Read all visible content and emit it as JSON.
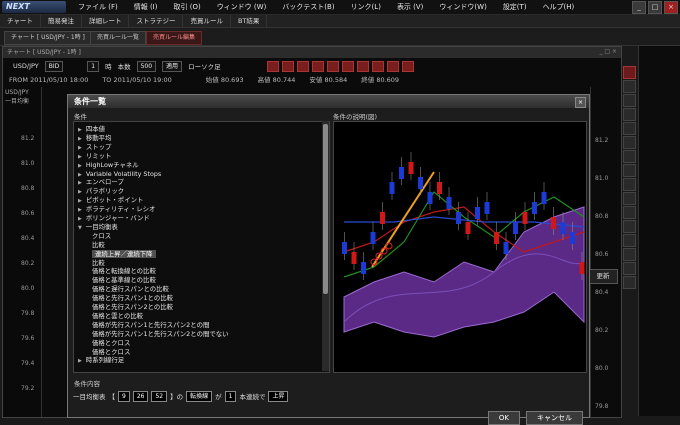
{
  "app": {
    "logo_text": "NEXT",
    "menu": [
      "ファイル (F)",
      "情報 (I)",
      "取引 (O)",
      "ウィンドウ (W)",
      "バックテスト(B)",
      "リンク(L)",
      "表示 (V)",
      "ウィンドウ(W)",
      "設定(T)",
      "ヘルプ(H)"
    ]
  },
  "toolbar": {
    "items": [
      "チャート",
      "簡易発注",
      "詳細レート",
      "ストラテジー",
      "売買ルール",
      "BT結果"
    ]
  },
  "tabs": [
    {
      "label": "チャート [ USD/JPY - 1時 ]"
    },
    {
      "label": "売買ルール一覧"
    },
    {
      "label": "売買ルール編集"
    }
  ],
  "chart_window": {
    "title": "チャート [ USD/JPY - 1時 ]",
    "symbol": "USD/JPY",
    "side": "BID",
    "period_value": "1",
    "period_unit": "時",
    "bars_label": "本数",
    "bars_value": "500",
    "apply_label": "適用",
    "candle_label": "ローソク足",
    "from_label": "FROM",
    "from_value": "2011/05/10 18:00",
    "to_label": "TO",
    "to_value": "2011/05/10 19:00",
    "open_label": "始値",
    "open_value": "80.693",
    "high_label": "高値",
    "high_value": "80.744",
    "low_label": "安値",
    "low_value": "80.584",
    "close_label": "終値",
    "close_value": "80.609",
    "left_label_line1": "USD/JPY",
    "left_label_line2": "一目均衡",
    "left_ticks": [
      "81.2",
      "81.0",
      "80.8",
      "80.6",
      "80.4",
      "80.2",
      "80.0",
      "79.8",
      "79.6",
      "79.4",
      "79.2"
    ],
    "right_ticks": [
      "81.2",
      "81.0",
      "80.8",
      "80.6",
      "80.4",
      "80.2",
      "80.0",
      "79.8"
    ],
    "refresh_label": "更新"
  },
  "dialog": {
    "title": "条件一覧",
    "conditions_header": "条件",
    "description_header": "条件の説明(図)",
    "content_header": "条件内容",
    "tree": [
      {
        "label": "四本値",
        "level": 0
      },
      {
        "label": "移動平均",
        "level": 0
      },
      {
        "label": "ストップ",
        "level": 0
      },
      {
        "label": "リミット",
        "level": 0
      },
      {
        "label": "HighLowチャネル",
        "level": 0
      },
      {
        "label": "Variable Volatility Stops",
        "level": 0
      },
      {
        "label": "エンベロープ",
        "level": 0
      },
      {
        "label": "パラボリック",
        "level": 0
      },
      {
        "label": "ピボット・ポイント",
        "level": 0
      },
      {
        "label": "ボラティリティ・レシオ",
        "level": 0
      },
      {
        "label": "ボリンジャー・バンド",
        "level": 0
      },
      {
        "label": "一目均衡表",
        "level": 0,
        "expanded": true
      },
      {
        "label": "クロス",
        "level": 1
      },
      {
        "label": "比較",
        "level": 1
      },
      {
        "label": "連続上昇／連続下降",
        "level": 1,
        "selected": true
      },
      {
        "label": "比較",
        "level": 1
      },
      {
        "label": "価格と転換線との比較",
        "level": 1
      },
      {
        "label": "価格と基準線との比較",
        "level": 1
      },
      {
        "label": "価格と遅行スパンとの比較",
        "level": 1
      },
      {
        "label": "価格と先行スパン1との比較",
        "level": 1
      },
      {
        "label": "価格と先行スパン2との比較",
        "level": 1
      },
      {
        "label": "価格と雲との比較",
        "level": 1
      },
      {
        "label": "価格が先行スパン1と先行スパン2との間",
        "level": 1
      },
      {
        "label": "価格が先行スパン1と先行スパン2との間でない",
        "level": 1
      },
      {
        "label": "価格とクロス",
        "level": 1
      },
      {
        "label": "価格とクロス",
        "level": 1
      },
      {
        "label": "時系列線行足",
        "level": 0
      }
    ],
    "content": {
      "indicator": "一目均衡表",
      "bracket_open": "【",
      "p1": "9",
      "p2": "26",
      "p3": "52",
      "bracket_close": "】の",
      "line_name": "転換線",
      "ga": "が",
      "count": "1",
      "suffix": "本連続で",
      "direction": "上昇"
    },
    "ok_label": "OK",
    "cancel_label": "キャンセル"
  }
}
